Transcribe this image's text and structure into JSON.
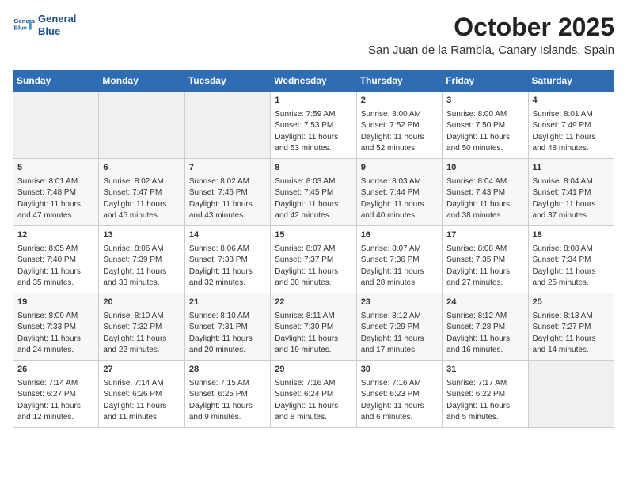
{
  "header": {
    "logo_line1": "General",
    "logo_line2": "Blue",
    "month_year": "October 2025",
    "location": "San Juan de la Rambla, Canary Islands, Spain"
  },
  "days_of_week": [
    "Sunday",
    "Monday",
    "Tuesday",
    "Wednesday",
    "Thursday",
    "Friday",
    "Saturday"
  ],
  "weeks": [
    [
      {
        "day": "",
        "sunrise": "",
        "sunset": "",
        "daylight": ""
      },
      {
        "day": "",
        "sunrise": "",
        "sunset": "",
        "daylight": ""
      },
      {
        "day": "",
        "sunrise": "",
        "sunset": "",
        "daylight": ""
      },
      {
        "day": "1",
        "sunrise": "Sunrise: 7:59 AM",
        "sunset": "Sunset: 7:53 PM",
        "daylight": "Daylight: 11 hours and 53 minutes."
      },
      {
        "day": "2",
        "sunrise": "Sunrise: 8:00 AM",
        "sunset": "Sunset: 7:52 PM",
        "daylight": "Daylight: 11 hours and 52 minutes."
      },
      {
        "day": "3",
        "sunrise": "Sunrise: 8:00 AM",
        "sunset": "Sunset: 7:50 PM",
        "daylight": "Daylight: 11 hours and 50 minutes."
      },
      {
        "day": "4",
        "sunrise": "Sunrise: 8:01 AM",
        "sunset": "Sunset: 7:49 PM",
        "daylight": "Daylight: 11 hours and 48 minutes."
      }
    ],
    [
      {
        "day": "5",
        "sunrise": "Sunrise: 8:01 AM",
        "sunset": "Sunset: 7:48 PM",
        "daylight": "Daylight: 11 hours and 47 minutes."
      },
      {
        "day": "6",
        "sunrise": "Sunrise: 8:02 AM",
        "sunset": "Sunset: 7:47 PM",
        "daylight": "Daylight: 11 hours and 45 minutes."
      },
      {
        "day": "7",
        "sunrise": "Sunrise: 8:02 AM",
        "sunset": "Sunset: 7:46 PM",
        "daylight": "Daylight: 11 hours and 43 minutes."
      },
      {
        "day": "8",
        "sunrise": "Sunrise: 8:03 AM",
        "sunset": "Sunset: 7:45 PM",
        "daylight": "Daylight: 11 hours and 42 minutes."
      },
      {
        "day": "9",
        "sunrise": "Sunrise: 8:03 AM",
        "sunset": "Sunset: 7:44 PM",
        "daylight": "Daylight: 11 hours and 40 minutes."
      },
      {
        "day": "10",
        "sunrise": "Sunrise: 8:04 AM",
        "sunset": "Sunset: 7:43 PM",
        "daylight": "Daylight: 11 hours and 38 minutes."
      },
      {
        "day": "11",
        "sunrise": "Sunrise: 8:04 AM",
        "sunset": "Sunset: 7:41 PM",
        "daylight": "Daylight: 11 hours and 37 minutes."
      }
    ],
    [
      {
        "day": "12",
        "sunrise": "Sunrise: 8:05 AM",
        "sunset": "Sunset: 7:40 PM",
        "daylight": "Daylight: 11 hours and 35 minutes."
      },
      {
        "day": "13",
        "sunrise": "Sunrise: 8:06 AM",
        "sunset": "Sunset: 7:39 PM",
        "daylight": "Daylight: 11 hours and 33 minutes."
      },
      {
        "day": "14",
        "sunrise": "Sunrise: 8:06 AM",
        "sunset": "Sunset: 7:38 PM",
        "daylight": "Daylight: 11 hours and 32 minutes."
      },
      {
        "day": "15",
        "sunrise": "Sunrise: 8:07 AM",
        "sunset": "Sunset: 7:37 PM",
        "daylight": "Daylight: 11 hours and 30 minutes."
      },
      {
        "day": "16",
        "sunrise": "Sunrise: 8:07 AM",
        "sunset": "Sunset: 7:36 PM",
        "daylight": "Daylight: 11 hours and 28 minutes."
      },
      {
        "day": "17",
        "sunrise": "Sunrise: 8:08 AM",
        "sunset": "Sunset: 7:35 PM",
        "daylight": "Daylight: 11 hours and 27 minutes."
      },
      {
        "day": "18",
        "sunrise": "Sunrise: 8:08 AM",
        "sunset": "Sunset: 7:34 PM",
        "daylight": "Daylight: 11 hours and 25 minutes."
      }
    ],
    [
      {
        "day": "19",
        "sunrise": "Sunrise: 8:09 AM",
        "sunset": "Sunset: 7:33 PM",
        "daylight": "Daylight: 11 hours and 24 minutes."
      },
      {
        "day": "20",
        "sunrise": "Sunrise: 8:10 AM",
        "sunset": "Sunset: 7:32 PM",
        "daylight": "Daylight: 11 hours and 22 minutes."
      },
      {
        "day": "21",
        "sunrise": "Sunrise: 8:10 AM",
        "sunset": "Sunset: 7:31 PM",
        "daylight": "Daylight: 11 hours and 20 minutes."
      },
      {
        "day": "22",
        "sunrise": "Sunrise: 8:11 AM",
        "sunset": "Sunset: 7:30 PM",
        "daylight": "Daylight: 11 hours and 19 minutes."
      },
      {
        "day": "23",
        "sunrise": "Sunrise: 8:12 AM",
        "sunset": "Sunset: 7:29 PM",
        "daylight": "Daylight: 11 hours and 17 minutes."
      },
      {
        "day": "24",
        "sunrise": "Sunrise: 8:12 AM",
        "sunset": "Sunset: 7:28 PM",
        "daylight": "Daylight: 11 hours and 16 minutes."
      },
      {
        "day": "25",
        "sunrise": "Sunrise: 8:13 AM",
        "sunset": "Sunset: 7:27 PM",
        "daylight": "Daylight: 11 hours and 14 minutes."
      }
    ],
    [
      {
        "day": "26",
        "sunrise": "Sunrise: 7:14 AM",
        "sunset": "Sunset: 6:27 PM",
        "daylight": "Daylight: 11 hours and 12 minutes."
      },
      {
        "day": "27",
        "sunrise": "Sunrise: 7:14 AM",
        "sunset": "Sunset: 6:26 PM",
        "daylight": "Daylight: 11 hours and 11 minutes."
      },
      {
        "day": "28",
        "sunrise": "Sunrise: 7:15 AM",
        "sunset": "Sunset: 6:25 PM",
        "daylight": "Daylight: 11 hours and 9 minutes."
      },
      {
        "day": "29",
        "sunrise": "Sunrise: 7:16 AM",
        "sunset": "Sunset: 6:24 PM",
        "daylight": "Daylight: 11 hours and 8 minutes."
      },
      {
        "day": "30",
        "sunrise": "Sunrise: 7:16 AM",
        "sunset": "Sunset: 6:23 PM",
        "daylight": "Daylight: 11 hours and 6 minutes."
      },
      {
        "day": "31",
        "sunrise": "Sunrise: 7:17 AM",
        "sunset": "Sunset: 6:22 PM",
        "daylight": "Daylight: 11 hours and 5 minutes."
      },
      {
        "day": "",
        "sunrise": "",
        "sunset": "",
        "daylight": ""
      }
    ]
  ]
}
